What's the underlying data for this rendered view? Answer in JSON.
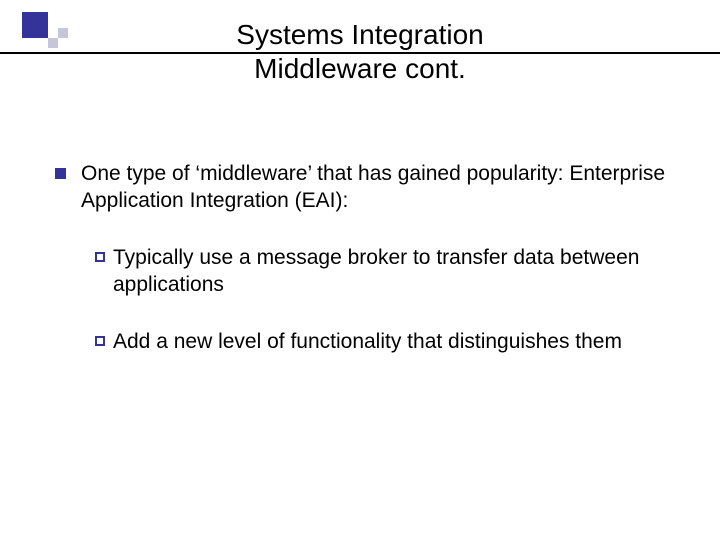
{
  "title_line1": "Systems Integration",
  "title_line2": "Middleware cont.",
  "point1": "One type of ‘middleware’ that has gained popularity: Enterprise Application Integration (EAI):",
  "sub1": "Typically use a message broker to transfer data between applications",
  "sub2": "Add a new level of functionality that distinguishes them"
}
